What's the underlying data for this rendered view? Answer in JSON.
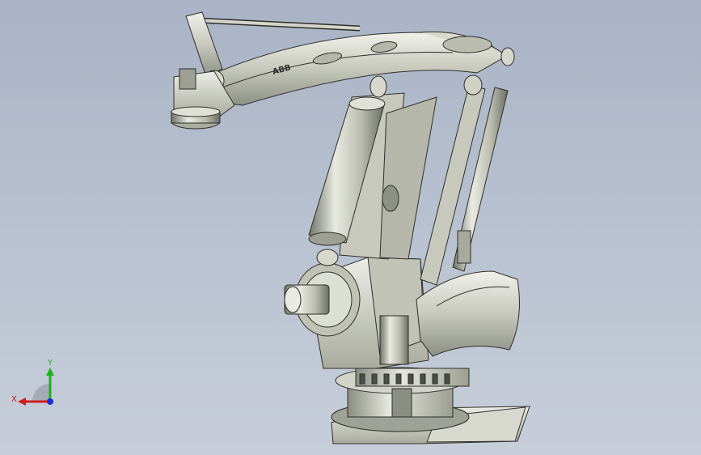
{
  "viewport": {
    "background_top": "#a9b3c5",
    "background_bottom": "#c7ced9"
  },
  "model": {
    "name_on_arm": "ABB",
    "metal_light": "#e4e6dc",
    "metal_mid": "#b9bcae",
    "metal_dark": "#7f8377",
    "edge": "#2e2f2a"
  },
  "triad": {
    "x_label": "X",
    "y_label": "Y",
    "x_color": "#d11a1a",
    "y_color": "#18b41a",
    "z_color": "#1a2fd1"
  }
}
